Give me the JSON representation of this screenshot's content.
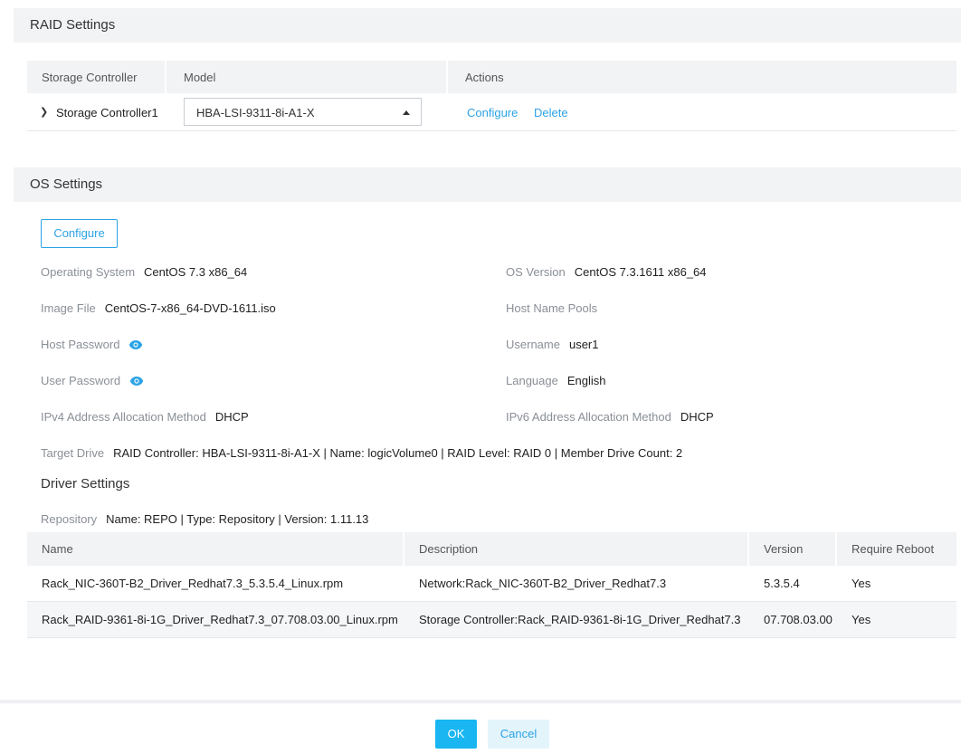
{
  "raid_settings": {
    "title": "RAID Settings",
    "columns": [
      "Storage Controller",
      "Model",
      "Actions"
    ],
    "row": {
      "controller": "Storage Controller1",
      "model": "HBA-LSI-9311-8i-A1-X",
      "configure_label": "Configure",
      "delete_label": "Delete"
    }
  },
  "os_settings": {
    "title": "OS Settings",
    "configure_label": "Configure",
    "fields": {
      "operating_system": {
        "label": "Operating System",
        "value": "CentOS 7.3 x86_64"
      },
      "os_version": {
        "label": "OS Version",
        "value": "CentOS 7.3.1611 x86_64"
      },
      "image_file": {
        "label": "Image File",
        "value": "CentOS-7-x86_64-DVD-1611.iso"
      },
      "host_name_pools": {
        "label": "Host Name Pools",
        "value": ""
      },
      "host_password": {
        "label": "Host Password",
        "icon": "eye-icon"
      },
      "username": {
        "label": "Username",
        "value": "user1"
      },
      "user_password": {
        "label": "User Password",
        "icon": "eye-icon"
      },
      "language": {
        "label": "Language",
        "value": "English"
      },
      "ipv4": {
        "label": "IPv4 Address Allocation Method",
        "value": "DHCP"
      },
      "ipv6": {
        "label": "IPv6 Address Allocation Method",
        "value": "DHCP"
      },
      "target_drive": {
        "label": "Target Drive",
        "value": "RAID Controller: HBA-LSI-9311-8i-A1-X | Name: logicVolume0 | RAID Level: RAID 0 | Member Drive Count: 2"
      }
    }
  },
  "driver_settings": {
    "title": "Driver Settings",
    "repository": {
      "label": "Repository",
      "value": "Name: REPO | Type: Repository | Version: 1.11.13"
    },
    "columns": [
      "Name",
      "Description",
      "Version",
      "Require Reboot"
    ],
    "rows": [
      {
        "name": "Rack_NIC-360T-B2_Driver_Redhat7.3_5.3.5.4_Linux.rpm",
        "description": "Network:Rack_NIC-360T-B2_Driver_Redhat7.3",
        "version": "5.3.5.4",
        "reboot": "Yes"
      },
      {
        "name": "Rack_RAID-9361-8i-1G_Driver_Redhat7.3_07.708.03.00_Linux.rpm",
        "description": "Storage Controller:Rack_RAID-9361-8i-1G_Driver_Redhat7.3",
        "version": "07.708.03.00",
        "reboot": "Yes"
      }
    ]
  },
  "footer": {
    "ok_label": "OK",
    "cancel_label": "Cancel"
  },
  "colors": {
    "accent": "#2ba3e6",
    "primary_button": "#19b6f2",
    "header_bg": "#f2f3f5"
  }
}
